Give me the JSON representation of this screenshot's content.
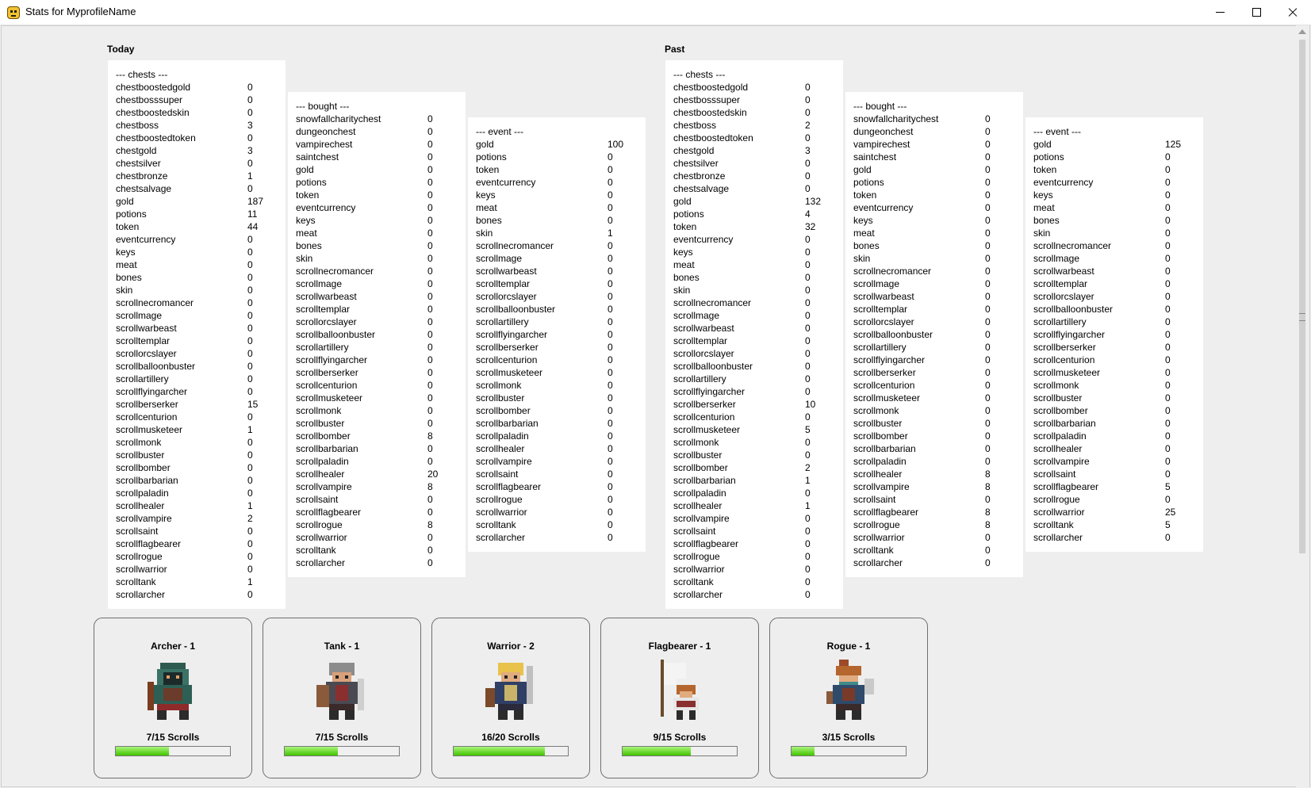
{
  "window": {
    "title": "Stats for MyprofileName"
  },
  "today": {
    "label": "Today",
    "chests": {
      "header": "--- chests ---",
      "rows": [
        [
          "chestboostedgold",
          "0"
        ],
        [
          "chestbosssuper",
          "0"
        ],
        [
          "chestboostedskin",
          "0"
        ],
        [
          "chestboss",
          "3"
        ],
        [
          "chestboostedtoken",
          "0"
        ],
        [
          "chestgold",
          "3"
        ],
        [
          "chestsilver",
          "0"
        ],
        [
          "chestbronze",
          "1"
        ],
        [
          "chestsalvage",
          "0"
        ],
        [
          "gold",
          "187"
        ],
        [
          "potions",
          "11"
        ],
        [
          "token",
          "44"
        ],
        [
          "eventcurrency",
          "0"
        ],
        [
          "keys",
          "0"
        ],
        [
          "meat",
          "0"
        ],
        [
          "bones",
          "0"
        ],
        [
          "skin",
          "0"
        ],
        [
          "scrollnecromancer",
          "0"
        ],
        [
          "scrollmage",
          "0"
        ],
        [
          "scrollwarbeast",
          "0"
        ],
        [
          "scrolltemplar",
          "0"
        ],
        [
          "scrollorcslayer",
          "0"
        ],
        [
          "scrollballoonbuster",
          "0"
        ],
        [
          "scrollartillery",
          "0"
        ],
        [
          "scrollflyingarcher",
          "0"
        ],
        [
          "scrollberserker",
          "15"
        ],
        [
          "scrollcenturion",
          "0"
        ],
        [
          "scrollmusketeer",
          "1"
        ],
        [
          "scrollmonk",
          "0"
        ],
        [
          "scrollbuster",
          "0"
        ],
        [
          "scrollbomber",
          "0"
        ],
        [
          "scrollbarbarian",
          "0"
        ],
        [
          "scrollpaladin",
          "0"
        ],
        [
          "scrollhealer",
          "1"
        ],
        [
          "scrollvampire",
          "2"
        ],
        [
          "scrollsaint",
          "0"
        ],
        [
          "scrollflagbearer",
          "0"
        ],
        [
          "scrollrogue",
          "0"
        ],
        [
          "scrollwarrior",
          "0"
        ],
        [
          "scrolltank",
          "1"
        ],
        [
          "scrollarcher",
          "0"
        ]
      ]
    },
    "bought": {
      "header": "--- bought ---",
      "rows": [
        [
          "snowfallcharitychest",
          "0"
        ],
        [
          "dungeonchest",
          "0"
        ],
        [
          "vampirechest",
          "0"
        ],
        [
          "saintchest",
          "0"
        ],
        [
          "gold",
          "0"
        ],
        [
          "potions",
          "0"
        ],
        [
          "token",
          "0"
        ],
        [
          "eventcurrency",
          "0"
        ],
        [
          "keys",
          "0"
        ],
        [
          "meat",
          "0"
        ],
        [
          "bones",
          "0"
        ],
        [
          "skin",
          "0"
        ],
        [
          "scrollnecromancer",
          "0"
        ],
        [
          "scrollmage",
          "0"
        ],
        [
          "scrollwarbeast",
          "0"
        ],
        [
          "scrolltemplar",
          "0"
        ],
        [
          "scrollorcslayer",
          "0"
        ],
        [
          "scrollballoonbuster",
          "0"
        ],
        [
          "scrollartillery",
          "0"
        ],
        [
          "scrollflyingarcher",
          "0"
        ],
        [
          "scrollberserker",
          "0"
        ],
        [
          "scrollcenturion",
          "0"
        ],
        [
          "scrollmusketeer",
          "0"
        ],
        [
          "scrollmonk",
          "0"
        ],
        [
          "scrollbuster",
          "0"
        ],
        [
          "scrollbomber",
          "8"
        ],
        [
          "scrollbarbarian",
          "0"
        ],
        [
          "scrollpaladin",
          "0"
        ],
        [
          "scrollhealer",
          "20"
        ],
        [
          "scrollvampire",
          "8"
        ],
        [
          "scrollsaint",
          "0"
        ],
        [
          "scrollflagbearer",
          "0"
        ],
        [
          "scrollrogue",
          "8"
        ],
        [
          "scrollwarrior",
          "0"
        ],
        [
          "scrolltank",
          "0"
        ],
        [
          "scrollarcher",
          "0"
        ]
      ]
    },
    "event": {
      "header": "--- event ---",
      "rows": [
        [
          "gold",
          "100"
        ],
        [
          "potions",
          "0"
        ],
        [
          "token",
          "0"
        ],
        [
          "eventcurrency",
          "0"
        ],
        [
          "keys",
          "0"
        ],
        [
          "meat",
          "0"
        ],
        [
          "bones",
          "0"
        ],
        [
          "skin",
          "1"
        ],
        [
          "scrollnecromancer",
          "0"
        ],
        [
          "scrollmage",
          "0"
        ],
        [
          "scrollwarbeast",
          "0"
        ],
        [
          "scrolltemplar",
          "0"
        ],
        [
          "scrollorcslayer",
          "0"
        ],
        [
          "scrollballoonbuster",
          "0"
        ],
        [
          "scrollartillery",
          "0"
        ],
        [
          "scrollflyingarcher",
          "0"
        ],
        [
          "scrollberserker",
          "0"
        ],
        [
          "scrollcenturion",
          "0"
        ],
        [
          "scrollmusketeer",
          "0"
        ],
        [
          "scrollmonk",
          "0"
        ],
        [
          "scrollbuster",
          "0"
        ],
        [
          "scrollbomber",
          "0"
        ],
        [
          "scrollbarbarian",
          "0"
        ],
        [
          "scrollpaladin",
          "0"
        ],
        [
          "scrollhealer",
          "0"
        ],
        [
          "scrollvampire",
          "0"
        ],
        [
          "scrollsaint",
          "0"
        ],
        [
          "scrollflagbearer",
          "0"
        ],
        [
          "scrollrogue",
          "0"
        ],
        [
          "scrollwarrior",
          "0"
        ],
        [
          "scrolltank",
          "0"
        ],
        [
          "scrollarcher",
          "0"
        ]
      ]
    }
  },
  "past": {
    "label": "Past",
    "chests": {
      "header": "--- chests ---",
      "rows": [
        [
          "chestboostedgold",
          "0"
        ],
        [
          "chestbosssuper",
          "0"
        ],
        [
          "chestboostedskin",
          "0"
        ],
        [
          "chestboss",
          "2"
        ],
        [
          "chestboostedtoken",
          "0"
        ],
        [
          "chestgold",
          "3"
        ],
        [
          "chestsilver",
          "0"
        ],
        [
          "chestbronze",
          "0"
        ],
        [
          "chestsalvage",
          "0"
        ],
        [
          "gold",
          "132"
        ],
        [
          "potions",
          "4"
        ],
        [
          "token",
          "32"
        ],
        [
          "eventcurrency",
          "0"
        ],
        [
          "keys",
          "0"
        ],
        [
          "meat",
          "0"
        ],
        [
          "bones",
          "0"
        ],
        [
          "skin",
          "0"
        ],
        [
          "scrollnecromancer",
          "0"
        ],
        [
          "scrollmage",
          "0"
        ],
        [
          "scrollwarbeast",
          "0"
        ],
        [
          "scrolltemplar",
          "0"
        ],
        [
          "scrollorcslayer",
          "0"
        ],
        [
          "scrollballoonbuster",
          "0"
        ],
        [
          "scrollartillery",
          "0"
        ],
        [
          "scrollflyingarcher",
          "0"
        ],
        [
          "scrollberserker",
          "10"
        ],
        [
          "scrollcenturion",
          "0"
        ],
        [
          "scrollmusketeer",
          "5"
        ],
        [
          "scrollmonk",
          "0"
        ],
        [
          "scrollbuster",
          "0"
        ],
        [
          "scrollbomber",
          "2"
        ],
        [
          "scrollbarbarian",
          "1"
        ],
        [
          "scrollpaladin",
          "0"
        ],
        [
          "scrollhealer",
          "1"
        ],
        [
          "scrollvampire",
          "0"
        ],
        [
          "scrollsaint",
          "0"
        ],
        [
          "scrollflagbearer",
          "0"
        ],
        [
          "scrollrogue",
          "0"
        ],
        [
          "scrollwarrior",
          "0"
        ],
        [
          "scrolltank",
          "0"
        ],
        [
          "scrollarcher",
          "0"
        ]
      ]
    },
    "bought": {
      "header": "--- bought ---",
      "rows": [
        [
          "snowfallcharitychest",
          "0"
        ],
        [
          "dungeonchest",
          "0"
        ],
        [
          "vampirechest",
          "0"
        ],
        [
          "saintchest",
          "0"
        ],
        [
          "gold",
          "0"
        ],
        [
          "potions",
          "0"
        ],
        [
          "token",
          "0"
        ],
        [
          "eventcurrency",
          "0"
        ],
        [
          "keys",
          "0"
        ],
        [
          "meat",
          "0"
        ],
        [
          "bones",
          "0"
        ],
        [
          "skin",
          "0"
        ],
        [
          "scrollnecromancer",
          "0"
        ],
        [
          "scrollmage",
          "0"
        ],
        [
          "scrollwarbeast",
          "0"
        ],
        [
          "scrolltemplar",
          "0"
        ],
        [
          "scrollorcslayer",
          "0"
        ],
        [
          "scrollballoonbuster",
          "0"
        ],
        [
          "scrollartillery",
          "0"
        ],
        [
          "scrollflyingarcher",
          "0"
        ],
        [
          "scrollberserker",
          "0"
        ],
        [
          "scrollcenturion",
          "0"
        ],
        [
          "scrollmusketeer",
          "0"
        ],
        [
          "scrollmonk",
          "0"
        ],
        [
          "scrollbuster",
          "0"
        ],
        [
          "scrollbomber",
          "0"
        ],
        [
          "scrollbarbarian",
          "0"
        ],
        [
          "scrollpaladin",
          "0"
        ],
        [
          "scrollhealer",
          "8"
        ],
        [
          "scrollvampire",
          "8"
        ],
        [
          "scrollsaint",
          "0"
        ],
        [
          "scrollflagbearer",
          "8"
        ],
        [
          "scrollrogue",
          "8"
        ],
        [
          "scrollwarrior",
          "0"
        ],
        [
          "scrolltank",
          "0"
        ],
        [
          "scrollarcher",
          "0"
        ]
      ]
    },
    "event": {
      "header": "--- event ---",
      "rows": [
        [
          "gold",
          "125"
        ],
        [
          "potions",
          "0"
        ],
        [
          "token",
          "0"
        ],
        [
          "eventcurrency",
          "0"
        ],
        [
          "keys",
          "0"
        ],
        [
          "meat",
          "0"
        ],
        [
          "bones",
          "0"
        ],
        [
          "skin",
          "0"
        ],
        [
          "scrollnecromancer",
          "0"
        ],
        [
          "scrollmage",
          "0"
        ],
        [
          "scrollwarbeast",
          "0"
        ],
        [
          "scrolltemplar",
          "0"
        ],
        [
          "scrollorcslayer",
          "0"
        ],
        [
          "scrollballoonbuster",
          "0"
        ],
        [
          "scrollartillery",
          "0"
        ],
        [
          "scrollflyingarcher",
          "0"
        ],
        [
          "scrollberserker",
          "0"
        ],
        [
          "scrollcenturion",
          "0"
        ],
        [
          "scrollmusketeer",
          "0"
        ],
        [
          "scrollmonk",
          "0"
        ],
        [
          "scrollbuster",
          "0"
        ],
        [
          "scrollbomber",
          "0"
        ],
        [
          "scrollbarbarian",
          "0"
        ],
        [
          "scrollpaladin",
          "0"
        ],
        [
          "scrollhealer",
          "0"
        ],
        [
          "scrollvampire",
          "0"
        ],
        [
          "scrollsaint",
          "0"
        ],
        [
          "scrollflagbearer",
          "5"
        ],
        [
          "scrollrogue",
          "0"
        ],
        [
          "scrollwarrior",
          "25"
        ],
        [
          "scrolltank",
          "5"
        ],
        [
          "scrollarcher",
          "0"
        ]
      ]
    }
  },
  "heroes": [
    {
      "title": "Archer - 1",
      "progress_text": "7/15 Scrolls",
      "progress": 0.467,
      "icon": "archer-hero-icon"
    },
    {
      "title": "Tank - 1",
      "progress_text": "7/15 Scrolls",
      "progress": 0.467,
      "icon": "tank-hero-icon"
    },
    {
      "title": "Warrior - 2",
      "progress_text": "16/20 Scrolls",
      "progress": 0.8,
      "icon": "warrior-hero-icon"
    },
    {
      "title": "Flagbearer - 1",
      "progress_text": "9/15 Scrolls",
      "progress": 0.6,
      "icon": "flagbearer-hero-icon"
    },
    {
      "title": "Rogue - 1",
      "progress_text": "3/15 Scrolls",
      "progress": 0.2,
      "icon": "rogue-hero-icon"
    }
  ],
  "colors": {
    "progress_fill": "#42c400",
    "panel_bg": "#ffffff",
    "window_bg": "#eeeeee"
  }
}
